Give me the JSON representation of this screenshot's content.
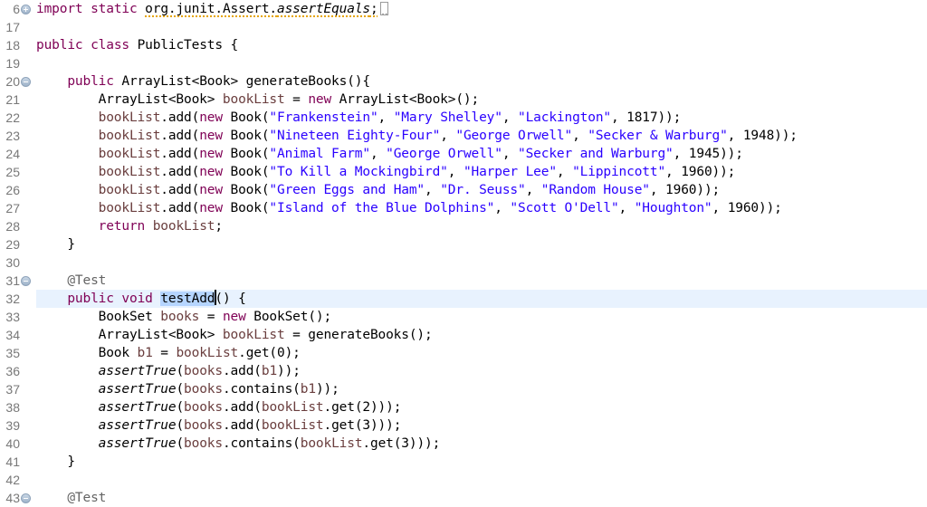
{
  "editor": {
    "language": "java",
    "colors": {
      "keyword": "#7f0055",
      "string": "#2a00ff",
      "local_variable": "#6a3e3e",
      "annotation": "#646464",
      "current_line": "#e8f2fe",
      "selection": "#b5d5ff"
    },
    "lines": [
      {
        "number": "6",
        "fold": "expand",
        "tokens": [
          {
            "t": "import",
            "c": "kw"
          },
          {
            "t": " "
          },
          {
            "t": "static",
            "c": "kw"
          },
          {
            "t": " "
          },
          {
            "t": "org.junit.Assert.",
            "c": "warn"
          },
          {
            "t": "assertEquals",
            "c": "it warn"
          },
          {
            "t": ";",
            "c": "warn"
          }
        ],
        "collapsed": true
      },
      {
        "number": "17",
        "tokens": []
      },
      {
        "number": "18",
        "tokens": [
          {
            "t": "public",
            "c": "kw"
          },
          {
            "t": " "
          },
          {
            "t": "class",
            "c": "kw"
          },
          {
            "t": " PublicTests {"
          }
        ]
      },
      {
        "number": "19",
        "tokens": []
      },
      {
        "number": "20",
        "fold": "collapse",
        "tokens": [
          {
            "t": "    "
          },
          {
            "t": "public",
            "c": "kw"
          },
          {
            "t": " ArrayList<Book> generateBooks(){"
          }
        ]
      },
      {
        "number": "21",
        "tokens": [
          {
            "t": "        ArrayList<Book> "
          },
          {
            "t": "bookList",
            "c": "var"
          },
          {
            "t": " = "
          },
          {
            "t": "new",
            "c": "kw"
          },
          {
            "t": " ArrayList<Book>();"
          }
        ]
      },
      {
        "number": "22",
        "tokens": [
          {
            "t": "        "
          },
          {
            "t": "bookList",
            "c": "var"
          },
          {
            "t": ".add("
          },
          {
            "t": "new",
            "c": "kw"
          },
          {
            "t": " Book("
          },
          {
            "t": "\"Frankenstein\"",
            "c": "str"
          },
          {
            "t": ", "
          },
          {
            "t": "\"Mary Shelley\"",
            "c": "str"
          },
          {
            "t": ", "
          },
          {
            "t": "\"Lackington\"",
            "c": "str"
          },
          {
            "t": ", 1817));"
          }
        ]
      },
      {
        "number": "23",
        "tokens": [
          {
            "t": "        "
          },
          {
            "t": "bookList",
            "c": "var"
          },
          {
            "t": ".add("
          },
          {
            "t": "new",
            "c": "kw"
          },
          {
            "t": " Book("
          },
          {
            "t": "\"Nineteen Eighty-Four\"",
            "c": "str"
          },
          {
            "t": ", "
          },
          {
            "t": "\"George Orwell\"",
            "c": "str"
          },
          {
            "t": ", "
          },
          {
            "t": "\"Secker & Warburg\"",
            "c": "str"
          },
          {
            "t": ", 1948));"
          }
        ]
      },
      {
        "number": "24",
        "tokens": [
          {
            "t": "        "
          },
          {
            "t": "bookList",
            "c": "var"
          },
          {
            "t": ".add("
          },
          {
            "t": "new",
            "c": "kw"
          },
          {
            "t": " Book("
          },
          {
            "t": "\"Animal Farm\"",
            "c": "str"
          },
          {
            "t": ", "
          },
          {
            "t": "\"George Orwell\"",
            "c": "str"
          },
          {
            "t": ", "
          },
          {
            "t": "\"Secker and Warburg\"",
            "c": "str"
          },
          {
            "t": ", 1945));"
          }
        ]
      },
      {
        "number": "25",
        "tokens": [
          {
            "t": "        "
          },
          {
            "t": "bookList",
            "c": "var"
          },
          {
            "t": ".add("
          },
          {
            "t": "new",
            "c": "kw"
          },
          {
            "t": " Book("
          },
          {
            "t": "\"To Kill a Mockingbird\"",
            "c": "str"
          },
          {
            "t": ", "
          },
          {
            "t": "\"Harper Lee\"",
            "c": "str"
          },
          {
            "t": ", "
          },
          {
            "t": "\"Lippincott\"",
            "c": "str"
          },
          {
            "t": ", 1960));"
          }
        ]
      },
      {
        "number": "26",
        "tokens": [
          {
            "t": "        "
          },
          {
            "t": "bookList",
            "c": "var"
          },
          {
            "t": ".add("
          },
          {
            "t": "new",
            "c": "kw"
          },
          {
            "t": " Book("
          },
          {
            "t": "\"Green Eggs and Ham\"",
            "c": "str"
          },
          {
            "t": ", "
          },
          {
            "t": "\"Dr. Seuss\"",
            "c": "str"
          },
          {
            "t": ", "
          },
          {
            "t": "\"Random House\"",
            "c": "str"
          },
          {
            "t": ", 1960));"
          }
        ]
      },
      {
        "number": "27",
        "tokens": [
          {
            "t": "        "
          },
          {
            "t": "bookList",
            "c": "var"
          },
          {
            "t": ".add("
          },
          {
            "t": "new",
            "c": "kw"
          },
          {
            "t": " Book("
          },
          {
            "t": "\"Island of the Blue Dolphins\"",
            "c": "str"
          },
          {
            "t": ", "
          },
          {
            "t": "\"Scott O'Dell\"",
            "c": "str"
          },
          {
            "t": ", "
          },
          {
            "t": "\"Houghton\"",
            "c": "str"
          },
          {
            "t": ", 1960));"
          }
        ]
      },
      {
        "number": "28",
        "tokens": [
          {
            "t": "        "
          },
          {
            "t": "return",
            "c": "kw"
          },
          {
            "t": " "
          },
          {
            "t": "bookList",
            "c": "var"
          },
          {
            "t": ";"
          }
        ]
      },
      {
        "number": "29",
        "tokens": [
          {
            "t": "    }"
          }
        ]
      },
      {
        "number": "30",
        "tokens": []
      },
      {
        "number": "31",
        "fold": "collapse",
        "tokens": [
          {
            "t": "    "
          },
          {
            "t": "@Test",
            "c": "ann"
          }
        ]
      },
      {
        "number": "32",
        "current": true,
        "tokens": [
          {
            "t": "    "
          },
          {
            "t": "public",
            "c": "kw"
          },
          {
            "t": " "
          },
          {
            "t": "void",
            "c": "kw"
          },
          {
            "t": " "
          },
          {
            "t": "testAdd",
            "c": "sel"
          },
          {
            "caret": true
          },
          {
            "t": "() {"
          }
        ]
      },
      {
        "number": "33",
        "tokens": [
          {
            "t": "        BookSet "
          },
          {
            "t": "books",
            "c": "var"
          },
          {
            "t": " = "
          },
          {
            "t": "new",
            "c": "kw"
          },
          {
            "t": " BookSet();"
          }
        ]
      },
      {
        "number": "34",
        "tokens": [
          {
            "t": "        ArrayList<Book> "
          },
          {
            "t": "bookList",
            "c": "var"
          },
          {
            "t": " = generateBooks();"
          }
        ]
      },
      {
        "number": "35",
        "tokens": [
          {
            "t": "        Book "
          },
          {
            "t": "b1",
            "c": "var"
          },
          {
            "t": " = "
          },
          {
            "t": "bookList",
            "c": "var"
          },
          {
            "t": ".get(0);"
          }
        ]
      },
      {
        "number": "36",
        "tokens": [
          {
            "t": "        "
          },
          {
            "t": "assertTrue",
            "c": "it"
          },
          {
            "t": "("
          },
          {
            "t": "books",
            "c": "var"
          },
          {
            "t": ".add("
          },
          {
            "t": "b1",
            "c": "var"
          },
          {
            "t": "));"
          }
        ]
      },
      {
        "number": "37",
        "tokens": [
          {
            "t": "        "
          },
          {
            "t": "assertTrue",
            "c": "it"
          },
          {
            "t": "("
          },
          {
            "t": "books",
            "c": "var"
          },
          {
            "t": ".contains("
          },
          {
            "t": "b1",
            "c": "var"
          },
          {
            "t": "));"
          }
        ]
      },
      {
        "number": "38",
        "tokens": [
          {
            "t": "        "
          },
          {
            "t": "assertTrue",
            "c": "it"
          },
          {
            "t": "("
          },
          {
            "t": "books",
            "c": "var"
          },
          {
            "t": ".add("
          },
          {
            "t": "bookList",
            "c": "var"
          },
          {
            "t": ".get(2)));"
          }
        ]
      },
      {
        "number": "39",
        "tokens": [
          {
            "t": "        "
          },
          {
            "t": "assertTrue",
            "c": "it"
          },
          {
            "t": "("
          },
          {
            "t": "books",
            "c": "var"
          },
          {
            "t": ".add("
          },
          {
            "t": "bookList",
            "c": "var"
          },
          {
            "t": ".get(3)));"
          }
        ]
      },
      {
        "number": "40",
        "tokens": [
          {
            "t": "        "
          },
          {
            "t": "assertTrue",
            "c": "it"
          },
          {
            "t": "("
          },
          {
            "t": "books",
            "c": "var"
          },
          {
            "t": ".contains("
          },
          {
            "t": "bookList",
            "c": "var"
          },
          {
            "t": ".get(3)));"
          }
        ]
      },
      {
        "number": "41",
        "tokens": [
          {
            "t": "    }"
          }
        ]
      },
      {
        "number": "42",
        "tokens": []
      },
      {
        "number": "43",
        "fold": "collapse",
        "tokens": [
          {
            "t": "    "
          },
          {
            "t": "@Test",
            "c": "ann"
          }
        ]
      }
    ]
  }
}
